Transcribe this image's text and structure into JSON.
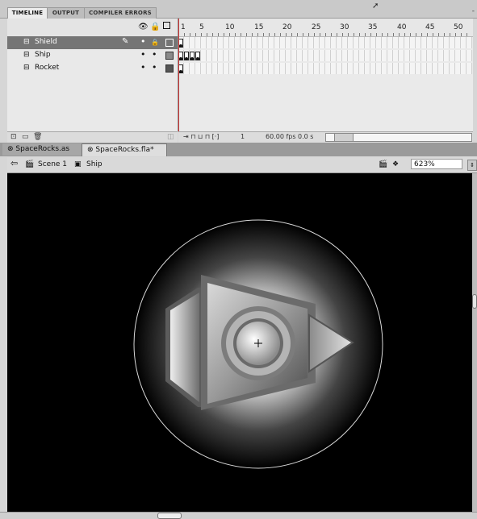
{
  "panel_tabs": [
    {
      "label": "TIMELINE",
      "active": true
    },
    {
      "label": "OUTPUT",
      "active": false
    },
    {
      "label": "COMPILER ERRORS",
      "active": false
    }
  ],
  "panel_menu": "-",
  "layers": [
    {
      "name": "Shield",
      "selected": true
    },
    {
      "name": "Ship",
      "selected": false
    },
    {
      "name": "Rocket",
      "selected": false
    }
  ],
  "ruler_numbers": [
    "1",
    "5",
    "10",
    "15",
    "20",
    "25",
    "30",
    "35",
    "40",
    "45",
    "50"
  ],
  "timeline_footer": {
    "current_frame": "1",
    "fps": "60.00 fps",
    "time": "0.0 s"
  },
  "doc_tabs": [
    {
      "label": "SpaceRocks.as",
      "active": false
    },
    {
      "label": "SpaceRocks.fla*",
      "active": true
    }
  ],
  "editbar": {
    "scene": "Scene 1",
    "symbol": "Ship",
    "zoom": "623%"
  },
  "colors": {
    "stage_bg": "#000000",
    "selected_layer": "#757575",
    "panel_bg": "#e9e9e9"
  },
  "icons": {
    "eye": "eye-icon",
    "lock": "lock-icon",
    "outline": "outline-icon",
    "layer": "layer-icon",
    "back": "back-arrow-icon",
    "scene": "scene-clapper-icon",
    "symbol": "movieclip-icon"
  }
}
